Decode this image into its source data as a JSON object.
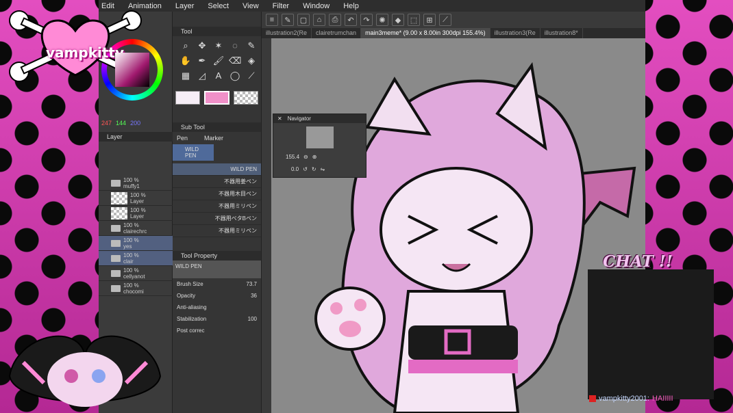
{
  "overlay": {
    "logo_text": "vampkitty",
    "chat_title": "CHAT !!",
    "chat_message": {
      "user": "vampkitty2001:",
      "text": "HAIIIII"
    }
  },
  "menu": [
    "Edit",
    "Animation",
    "Layer",
    "Select",
    "View",
    "Filter",
    "Window",
    "Help"
  ],
  "color": {
    "r": "247",
    "g": "144",
    "b": "200"
  },
  "panels": {
    "tool": "Tool",
    "layer": "Layer",
    "sub_tool": "Sub Tool",
    "tool_property": "Tool Property",
    "navigator": "Navigator"
  },
  "sub_tool_tabs": [
    "Pen",
    "Marker"
  ],
  "sub_tool_group": "WILD PEN",
  "brushes": [
    "WILD PEN",
    "不器用姜ペン",
    "不器用木目ペン",
    "不器用ミリペン",
    "不器用ベタBペン",
    "不器用ミリペン"
  ],
  "layers": [
    {
      "opacity": "100 %",
      "name": "muffy1",
      "type": "folder"
    },
    {
      "opacity": "100 %",
      "name": "Layer",
      "type": "layer"
    },
    {
      "opacity": "100 %",
      "name": "Layer",
      "type": "layer"
    },
    {
      "opacity": "100 %",
      "name": "clairechrc",
      "type": "folder"
    },
    {
      "opacity": "100 %",
      "name": "yes",
      "type": "folder"
    },
    {
      "opacity": "100 %",
      "name": "clair",
      "type": "folder"
    },
    {
      "opacity": "100 %",
      "name": "cellyanot",
      "type": "folder"
    },
    {
      "opacity": "100 %",
      "name": "chocomi",
      "type": "folder"
    }
  ],
  "tool_property": {
    "brush_name": "WILD PEN",
    "brush_size_label": "Brush Size",
    "brush_size_value": "73.7",
    "opacity_label": "Opacity",
    "opacity_value": "36",
    "anti_aliasing_label": "Anti-aliasing",
    "stabilization_label": "Stabilization",
    "stabilization_value": "100",
    "post_correction_label": "Post correc"
  },
  "tabs": [
    {
      "label": "illustration2(Re",
      "active": false
    },
    {
      "label": "clairetrumchan",
      "active": false
    },
    {
      "label": "main3meme* (9.00 x 8.00in 300dpi 155.4%)",
      "active": true
    },
    {
      "label": "illustration3(Re",
      "active": false
    },
    {
      "label": "illustration8*",
      "active": false
    }
  ],
  "navigator": {
    "zoom": "155.4",
    "angle": "0.0"
  }
}
